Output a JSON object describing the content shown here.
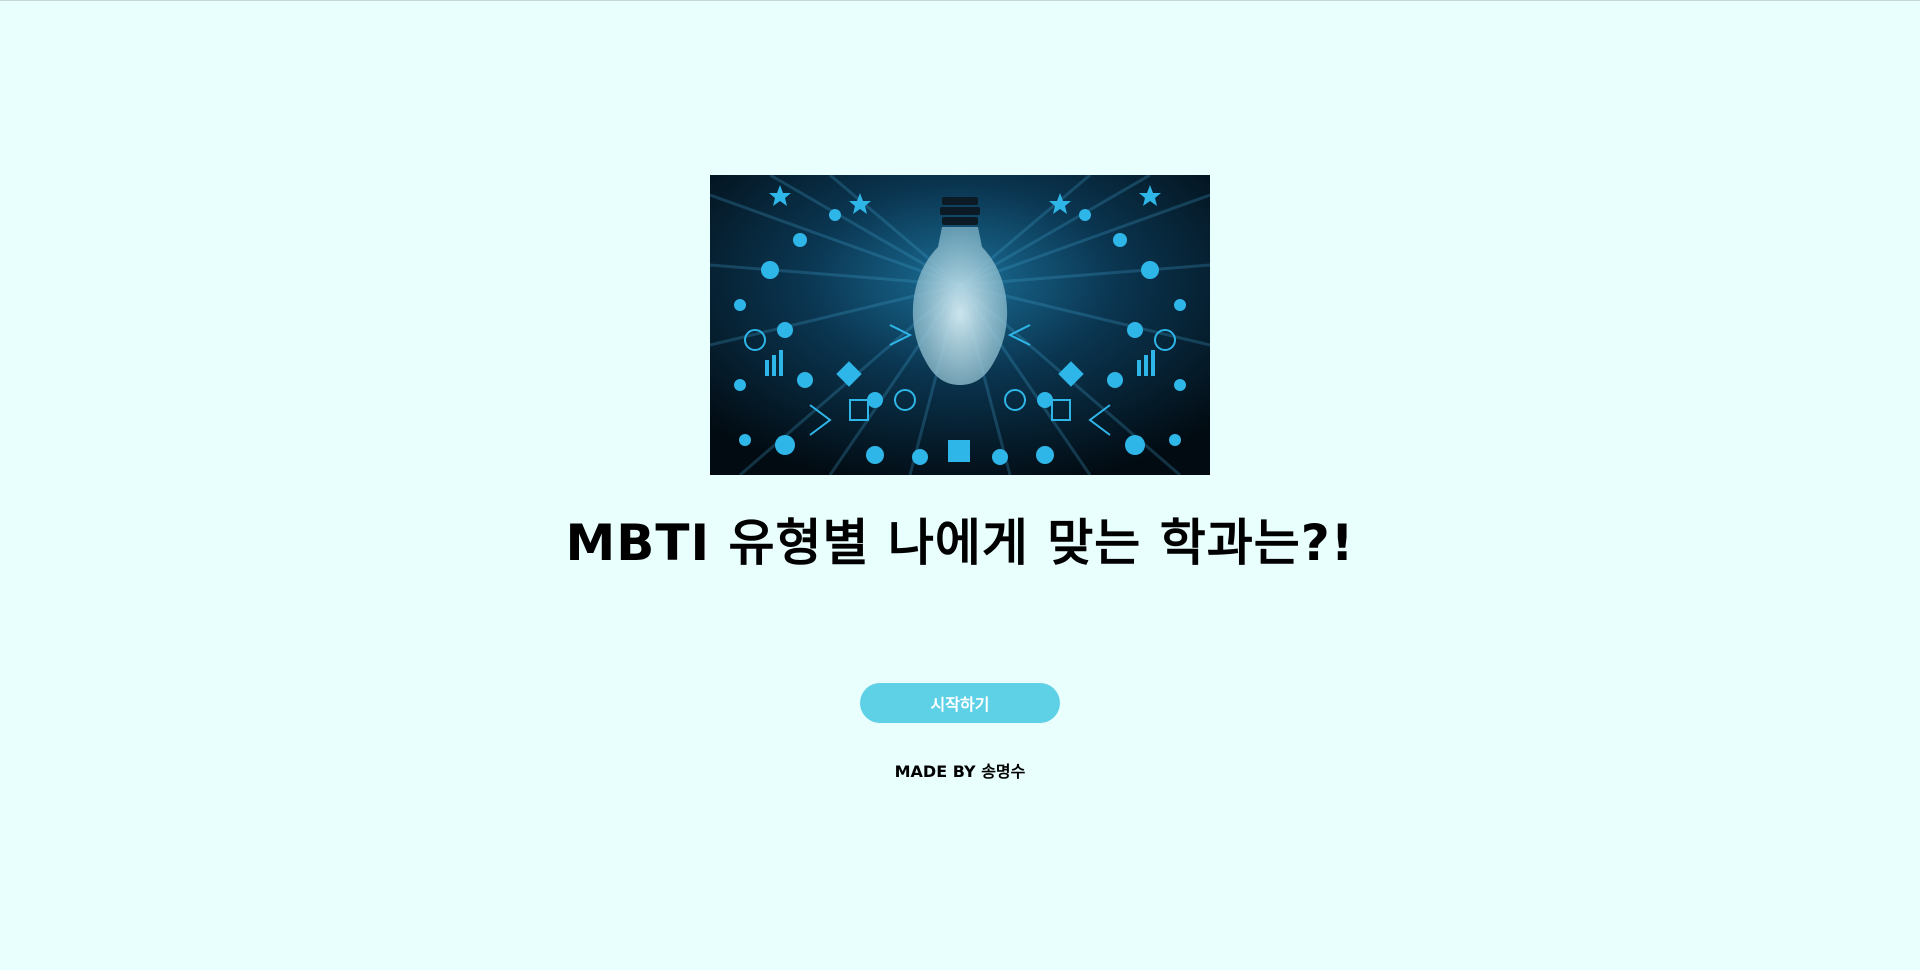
{
  "page": {
    "background_color": "#e9fffe"
  },
  "hero": {
    "image_description_icon": "lightbulb-education-icons-image",
    "background_color": "#04121c",
    "accent_color": "#2fb6e8"
  },
  "title": "MBTI 유형별 나에게 맞는 학과는?!",
  "start_button": {
    "label": "시작하기",
    "color": "#5ed1e6"
  },
  "credit": "MADE BY 송명수"
}
